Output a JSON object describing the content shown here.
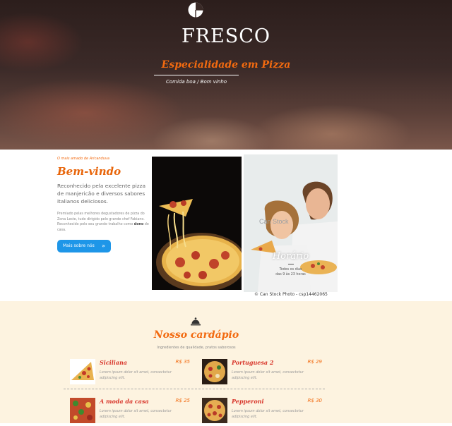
{
  "hero": {
    "title": "FRESCO",
    "subtitle": "Especialidade em Pizza",
    "tagline": "Comida boa / Bom vinho"
  },
  "about": {
    "eyebrow": "O mais amado de Aricanduva",
    "heading": "Bem-vindo",
    "lead": "Reconhecido pela excelente pizza de manjericão e diversos sabores italianos deliciosos.",
    "small_text": "Premiado pelas melhores degustadores de pizza do Zona Leste, tudo dirigido pelo grande chef Fabiano. Reconhecido pelo seu grande trabalho como",
    "small_bold": "dono",
    "small_end": "de casa.",
    "button_label": "Mais sobre nós",
    "button_arrow": "»",
    "hours_title": "Horário",
    "hours_line1": "Todos os dias",
    "hours_line2": "das 9 às 23 horas",
    "watermark": "Can Stock",
    "caption": "© Can Stock Photo - csp14462065"
  },
  "menu": {
    "title": "Nosso cardápio",
    "subtitle": "Ingredientes de qualidade, pratos saborosos",
    "items": [
      {
        "name": "Siciliana",
        "price": "R$ 35",
        "desc": "Lorem ipsum dolor sit amet, consectetur adipiscing elit."
      },
      {
        "name": "Portuguesa 2",
        "price": "R$ 29",
        "desc": "Lorem ipsum dolor sit amet, consectetur adipiscing elit."
      },
      {
        "name": "A moda da casa",
        "price": "R$ 25",
        "desc": "Lorem ipsum dolor sit amet, consectetur adipiscing elit."
      },
      {
        "name": "Pepperoni",
        "price": "R$ 30",
        "desc": "Lorem ipsum dolor sit amet, consectetur adipiscing elit."
      }
    ]
  },
  "colors": {
    "accent": "#f26a10",
    "button": "#1e96e8",
    "menu_bg": "#fdf3e0",
    "item_name": "#d8352a"
  },
  "icons": {
    "logo": "pie-chart-icon",
    "menu": "service-bell-icon",
    "button": "double-chevron-right-icon"
  }
}
